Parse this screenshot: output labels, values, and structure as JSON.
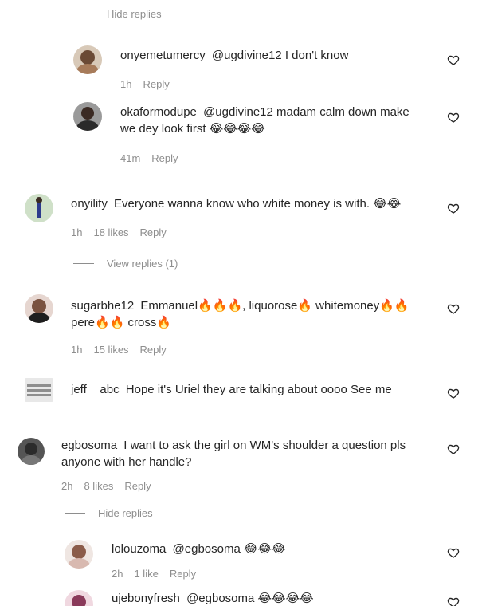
{
  "toggles": {
    "hide1": "Hide replies",
    "view1": "View replies (1)",
    "hide2": "Hide replies"
  },
  "comments": [
    {
      "user": "onyemetumercy",
      "text": "@ugdivine12 I don't know",
      "time": "1h",
      "reply": "Reply"
    },
    {
      "user": "okaformodupe",
      "text": "@ugdivine12 madam calm down make we dey look first 😂😂😂😂",
      "time": "41m",
      "reply": "Reply"
    },
    {
      "user": "onyility",
      "text": "Everyone wanna know who white money is with. 😂😂",
      "time": "1h",
      "likes": "18 likes",
      "reply": "Reply"
    },
    {
      "user": "sugarbhe12",
      "text": "Emmanuel🔥🔥🔥, liquorose🔥 whitemoney🔥🔥 pere🔥🔥 cross🔥",
      "time": "1h",
      "likes": "15 likes",
      "reply": "Reply"
    },
    {
      "user": "jeff__abc",
      "text": "Hope it's Uriel they are talking about oooo See me"
    },
    {
      "user": "egbosoma",
      "text": "I want to ask the girl on WM's shoulder a question pls anyone with her handle?",
      "time": "2h",
      "likes": "8 likes",
      "reply": "Reply"
    },
    {
      "user": "lolouzoma",
      "text": "@egbosoma 😂😂😂",
      "time": "2h",
      "likes": "1 like",
      "reply": "Reply"
    },
    {
      "user": "ujebonyfresh",
      "text": "@egbosoma 😂😂😂😂"
    }
  ],
  "icons": {
    "like": "heart-outline-icon"
  },
  "colors": {
    "muted": "#8e8e8e",
    "text": "#262626"
  }
}
